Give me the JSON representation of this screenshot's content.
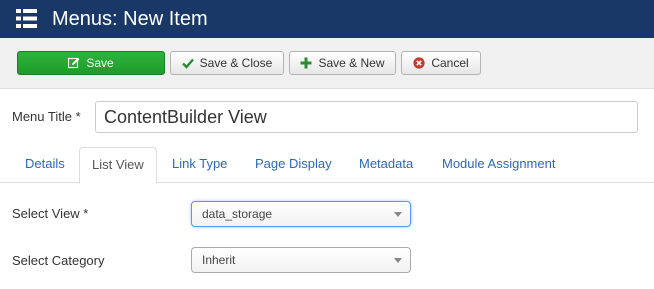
{
  "header": {
    "icon": "list-icon",
    "title": "Menus: New Item",
    "background": "#1a3867"
  },
  "toolbar": {
    "save_label": "Save",
    "save_close_label": "Save & Close",
    "save_new_label": "Save & New",
    "cancel_label": "Cancel",
    "save_color": "#21a531"
  },
  "form": {
    "menu_title_label": "Menu Title *",
    "menu_title_value": "ContentBuilder View"
  },
  "tabs": [
    {
      "label": "Details",
      "active": false
    },
    {
      "label": "List View",
      "active": true
    },
    {
      "label": "Link Type",
      "active": false
    },
    {
      "label": "Page Display",
      "active": false
    },
    {
      "label": "Metadata",
      "active": false
    },
    {
      "label": "Module Assignment",
      "active": false
    }
  ],
  "fields": {
    "select_view_label": "Select View *",
    "select_view_value": "data_storage",
    "select_category_label": "Select Category",
    "select_category_value": "Inherit"
  }
}
